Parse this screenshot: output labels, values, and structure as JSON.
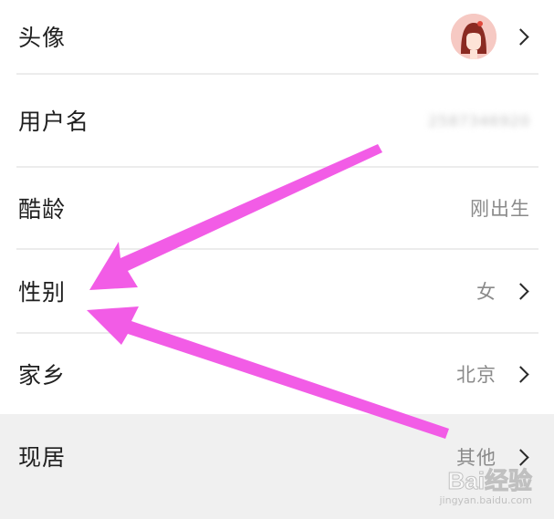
{
  "profile": {
    "rows": [
      {
        "label": "头像",
        "value": "",
        "has_chevron": true,
        "kind": "avatar"
      },
      {
        "label": "用户名",
        "value": "2587346920",
        "has_chevron": false,
        "kind": "blurred"
      },
      {
        "label": "酷龄",
        "value": "刚出生",
        "has_chevron": false,
        "kind": "text"
      },
      {
        "label": "性别",
        "value": "女",
        "has_chevron": true,
        "kind": "text"
      },
      {
        "label": "家乡",
        "value": "北京",
        "has_chevron": true,
        "kind": "text"
      },
      {
        "label": "现居",
        "value": "其他",
        "has_chevron": true,
        "kind": "text"
      }
    ]
  },
  "annotation": {
    "arrow_color": "#f25ce6"
  },
  "watermark": {
    "logo": "Bai经验",
    "sub": "jingyan.baidu.com"
  },
  "colors": {
    "background": "#ffffff",
    "label_text": "#1f1f1f",
    "value_text": "#8a8a8a",
    "separator": "#ececec",
    "highlight_row": "#f0f0f0",
    "avatar_bg": "#f6c9c3"
  },
  "icons": {
    "chevron": "chevron-right-icon",
    "avatar": "avatar-girl-icon"
  }
}
